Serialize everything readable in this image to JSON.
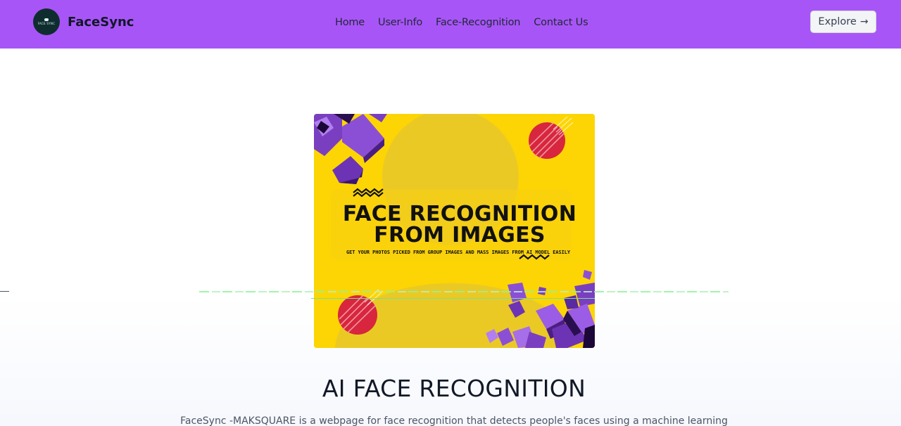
{
  "navbar": {
    "brand": "FaceSync",
    "logo_text": "FACE SYNC",
    "links": [
      "Home",
      "User-Info",
      "Face-Recognition",
      "Contact Us"
    ],
    "explore_label": "Explore",
    "background": "#a855f7"
  },
  "hero_image": {
    "headline_line1": "FACE RECOGNITION",
    "headline_line2": "FROM IMAGES",
    "tagline": "GET YOUR PHOTOS PICKED FROM GROUP IMAGES AND MASS IMAGES FROM AI MODEL EASILY",
    "background": "#fdd504",
    "accent_purple": "#8b4fd6",
    "accent_red": "#d7263d"
  },
  "content": {
    "title": "AI FACE RECOGNITION",
    "description": "FaceSync -MAKSQUARE is a webpage for face recognition that detects people's faces using a machine learning"
  }
}
